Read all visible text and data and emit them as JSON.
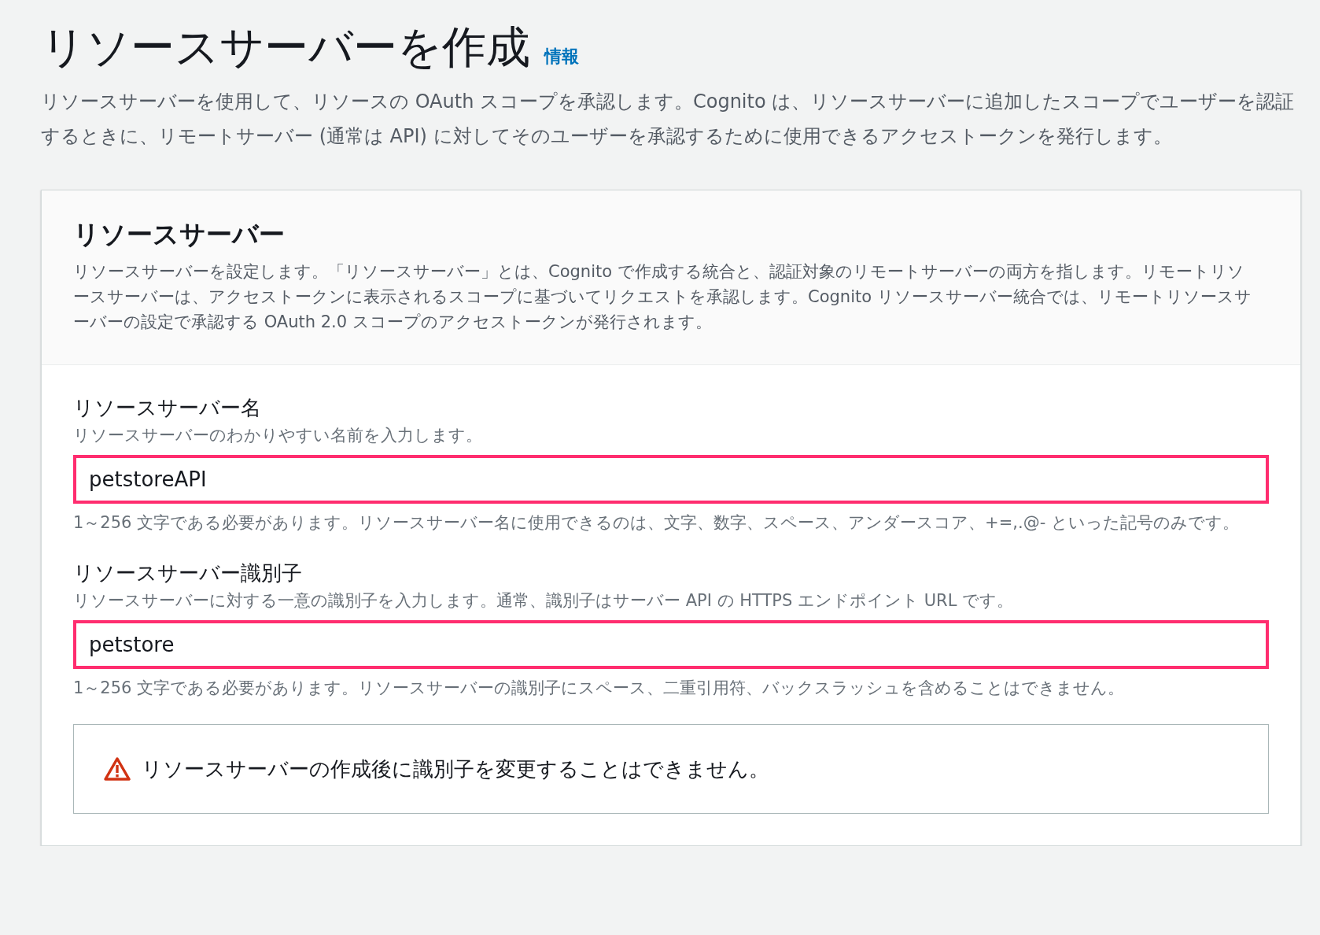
{
  "page": {
    "title": "リソースサーバーを作成",
    "info_link": "情報",
    "description": "リソースサーバーを使用して、リソースの OAuth スコープを承認します。Cognito は、リソースサーバーに追加したスコープでユーザーを認証するときに、リモートサーバー (通常は API) に対してそのユーザーを承認するために使用できるアクセストークンを発行します。"
  },
  "panel": {
    "heading": "リソースサーバー",
    "description": "リソースサーバーを設定します。「リソースサーバー」とは、Cognito で作成する統合と、認証対象のリモートサーバーの両方を指します。リモートリソースサーバーは、アクセストークンに表示されるスコープに基づいてリクエストを承認します。Cognito リソースサーバー統合では、リモートリソースサーバーの設定で承認する OAuth 2.0 スコープのアクセストークンが発行されます。",
    "fields": [
      {
        "label": "リソースサーバー名",
        "hint": "リソースサーバーのわかりやすい名前を入力します。",
        "value": "petstoreAPI",
        "constraint": "1～256 文字である必要があります。リソースサーバー名に使用できるのは、文字、数字、スペース、アンダースコア、+=,.@- といった記号のみです。"
      },
      {
        "label": "リソースサーバー識別子",
        "hint": "リソースサーバーに対する一意の識別子を入力します。通常、識別子はサーバー API の HTTPS エンドポイント URL です。",
        "value": "petstore",
        "constraint": "1～256 文字である必要があります。リソースサーバーの識別子にスペース、二重引用符、バックスラッシュを含めることはできません。"
      }
    ],
    "alert": {
      "kind": "warning",
      "text": "リソースサーバーの作成後に識別子を変更することはできません。"
    }
  }
}
